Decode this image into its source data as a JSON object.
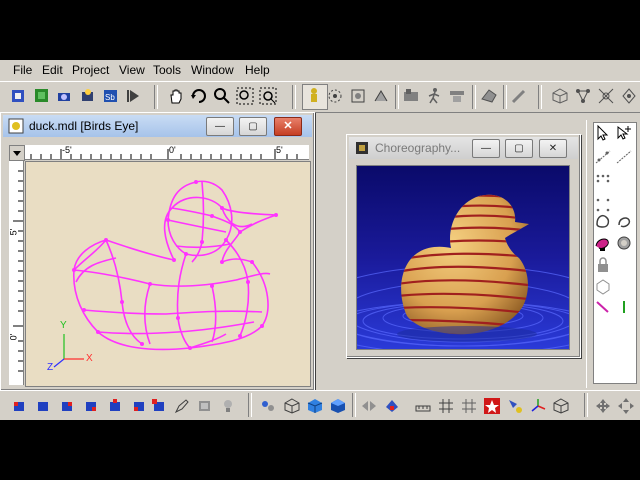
{
  "menu": {
    "file": "File",
    "edit": "Edit",
    "project": "Project",
    "view": "View",
    "tools": "Tools",
    "window": "Window",
    "help": "Help"
  },
  "model_window": {
    "title": "duck.mdl [Birds Eye]",
    "ruler_top": [
      "-5'",
      "0'",
      "5'"
    ],
    "ruler_left": [
      "5'",
      "0'"
    ],
    "axis_x": "X",
    "axis_y": "Y",
    "axis_z": "Z"
  },
  "render_window": {
    "title": "Choreography..."
  },
  "caption_buttons": {
    "minimize": "—",
    "maximize": "▢",
    "close": "✕"
  },
  "colors": {
    "wireframe": "#ff33ff",
    "viewport_bg": "#e9ddc3",
    "render_sky": "#0a0a6a",
    "water": "#2a3ad8",
    "duck_body": "#d9a050",
    "stripes": "#a0201e",
    "active_titlebar": "#b8cfee"
  },
  "icons": {
    "toolbar": [
      "new-model-icon",
      "import-icon",
      "camera-icon",
      "light-icon",
      "save-icon",
      "play-icon",
      "hand-pan-icon",
      "rotate-icon",
      "zoom-icon",
      "zoom-fit-icon",
      "zoom-all-icon",
      "bone-icon",
      "group-icon",
      "morph-icon",
      "hook-icon",
      "action-icon",
      "walk-icon",
      "skin-icon",
      "render-icon",
      "edit-icon",
      "cube-icon",
      "nodes-icon",
      "cp-icon",
      "lathe-icon"
    ],
    "right_panel": [
      "select-arrow-icon",
      "add-mode-icon",
      "spline-icon",
      "patch-icon",
      "grid-icon",
      "lasso-icon",
      "shape-icon",
      "paint-icon",
      "decal-icon",
      "lock-icon",
      "extrude-icon",
      "magnet-icon",
      "line-icon"
    ],
    "bottom": [
      "cube-red-icon",
      "cube-blue-icon",
      "cube-blue2-icon",
      "cube-blue3-icon",
      "cube-blue4-icon",
      "cube-mix-icon",
      "pen-icon",
      "stamp-icon",
      "light-bulb-icon",
      "atoms-icon",
      "wire-cube-icon",
      "solid-cube-icon",
      "shaded-cube-icon",
      "arrows-icon",
      "flag-icon",
      "measure-icon",
      "grid-toggle-icon",
      "hash-icon",
      "star-icon",
      "snap-icon",
      "axis-icon",
      "box-icon",
      "move-icon",
      "scale-icon"
    ]
  }
}
